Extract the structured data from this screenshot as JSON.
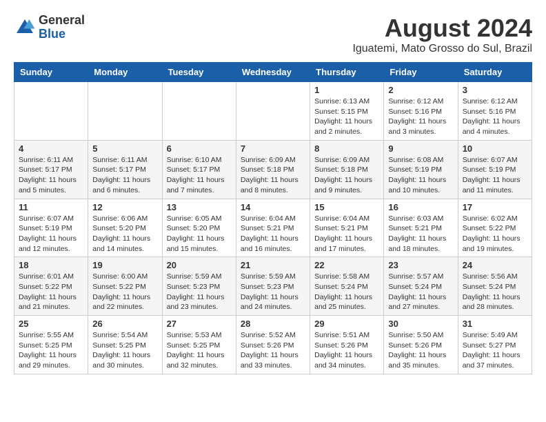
{
  "logo": {
    "general": "General",
    "blue": "Blue"
  },
  "title": "August 2024",
  "subtitle": "Iguatemi, Mato Grosso do Sul, Brazil",
  "weekdays": [
    "Sunday",
    "Monday",
    "Tuesday",
    "Wednesday",
    "Thursday",
    "Friday",
    "Saturday"
  ],
  "weeks": [
    [
      {
        "day": "",
        "info": ""
      },
      {
        "day": "",
        "info": ""
      },
      {
        "day": "",
        "info": ""
      },
      {
        "day": "",
        "info": ""
      },
      {
        "day": "1",
        "info": "Sunrise: 6:13 AM\nSunset: 5:15 PM\nDaylight: 11 hours and 2 minutes."
      },
      {
        "day": "2",
        "info": "Sunrise: 6:12 AM\nSunset: 5:16 PM\nDaylight: 11 hours and 3 minutes."
      },
      {
        "day": "3",
        "info": "Sunrise: 6:12 AM\nSunset: 5:16 PM\nDaylight: 11 hours and 4 minutes."
      }
    ],
    [
      {
        "day": "4",
        "info": "Sunrise: 6:11 AM\nSunset: 5:17 PM\nDaylight: 11 hours and 5 minutes."
      },
      {
        "day": "5",
        "info": "Sunrise: 6:11 AM\nSunset: 5:17 PM\nDaylight: 11 hours and 6 minutes."
      },
      {
        "day": "6",
        "info": "Sunrise: 6:10 AM\nSunset: 5:17 PM\nDaylight: 11 hours and 7 minutes."
      },
      {
        "day": "7",
        "info": "Sunrise: 6:09 AM\nSunset: 5:18 PM\nDaylight: 11 hours and 8 minutes."
      },
      {
        "day": "8",
        "info": "Sunrise: 6:09 AM\nSunset: 5:18 PM\nDaylight: 11 hours and 9 minutes."
      },
      {
        "day": "9",
        "info": "Sunrise: 6:08 AM\nSunset: 5:19 PM\nDaylight: 11 hours and 10 minutes."
      },
      {
        "day": "10",
        "info": "Sunrise: 6:07 AM\nSunset: 5:19 PM\nDaylight: 11 hours and 11 minutes."
      }
    ],
    [
      {
        "day": "11",
        "info": "Sunrise: 6:07 AM\nSunset: 5:19 PM\nDaylight: 11 hours and 12 minutes."
      },
      {
        "day": "12",
        "info": "Sunrise: 6:06 AM\nSunset: 5:20 PM\nDaylight: 11 hours and 14 minutes."
      },
      {
        "day": "13",
        "info": "Sunrise: 6:05 AM\nSunset: 5:20 PM\nDaylight: 11 hours and 15 minutes."
      },
      {
        "day": "14",
        "info": "Sunrise: 6:04 AM\nSunset: 5:21 PM\nDaylight: 11 hours and 16 minutes."
      },
      {
        "day": "15",
        "info": "Sunrise: 6:04 AM\nSunset: 5:21 PM\nDaylight: 11 hours and 17 minutes."
      },
      {
        "day": "16",
        "info": "Sunrise: 6:03 AM\nSunset: 5:21 PM\nDaylight: 11 hours and 18 minutes."
      },
      {
        "day": "17",
        "info": "Sunrise: 6:02 AM\nSunset: 5:22 PM\nDaylight: 11 hours and 19 minutes."
      }
    ],
    [
      {
        "day": "18",
        "info": "Sunrise: 6:01 AM\nSunset: 5:22 PM\nDaylight: 11 hours and 21 minutes."
      },
      {
        "day": "19",
        "info": "Sunrise: 6:00 AM\nSunset: 5:22 PM\nDaylight: 11 hours and 22 minutes."
      },
      {
        "day": "20",
        "info": "Sunrise: 5:59 AM\nSunset: 5:23 PM\nDaylight: 11 hours and 23 minutes."
      },
      {
        "day": "21",
        "info": "Sunrise: 5:59 AM\nSunset: 5:23 PM\nDaylight: 11 hours and 24 minutes."
      },
      {
        "day": "22",
        "info": "Sunrise: 5:58 AM\nSunset: 5:24 PM\nDaylight: 11 hours and 25 minutes."
      },
      {
        "day": "23",
        "info": "Sunrise: 5:57 AM\nSunset: 5:24 PM\nDaylight: 11 hours and 27 minutes."
      },
      {
        "day": "24",
        "info": "Sunrise: 5:56 AM\nSunset: 5:24 PM\nDaylight: 11 hours and 28 minutes."
      }
    ],
    [
      {
        "day": "25",
        "info": "Sunrise: 5:55 AM\nSunset: 5:25 PM\nDaylight: 11 hours and 29 minutes."
      },
      {
        "day": "26",
        "info": "Sunrise: 5:54 AM\nSunset: 5:25 PM\nDaylight: 11 hours and 30 minutes."
      },
      {
        "day": "27",
        "info": "Sunrise: 5:53 AM\nSunset: 5:25 PM\nDaylight: 11 hours and 32 minutes."
      },
      {
        "day": "28",
        "info": "Sunrise: 5:52 AM\nSunset: 5:26 PM\nDaylight: 11 hours and 33 minutes."
      },
      {
        "day": "29",
        "info": "Sunrise: 5:51 AM\nSunset: 5:26 PM\nDaylight: 11 hours and 34 minutes."
      },
      {
        "day": "30",
        "info": "Sunrise: 5:50 AM\nSunset: 5:26 PM\nDaylight: 11 hours and 35 minutes."
      },
      {
        "day": "31",
        "info": "Sunrise: 5:49 AM\nSunset: 5:27 PM\nDaylight: 11 hours and 37 minutes."
      }
    ]
  ]
}
